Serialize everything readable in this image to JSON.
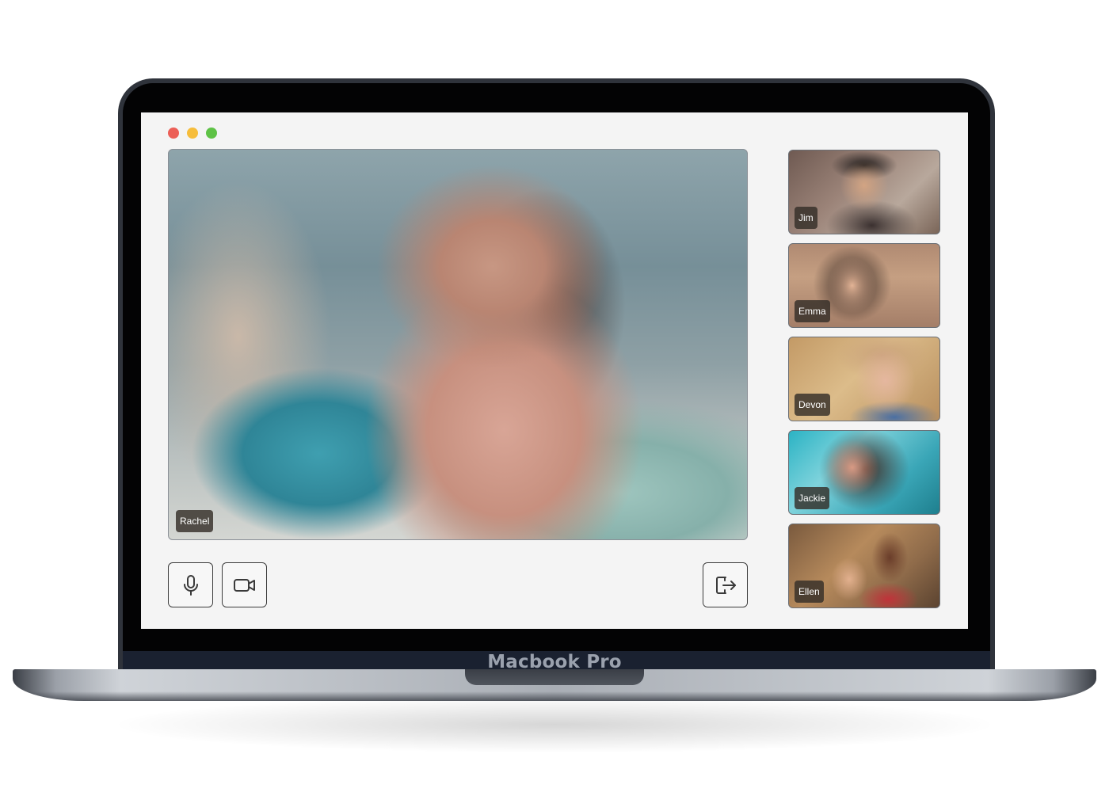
{
  "device": {
    "model_label": "Macbook Pro"
  },
  "window": {
    "traffic_lights": [
      {
        "name": "close",
        "color": "#ec5f57"
      },
      {
        "name": "minimize",
        "color": "#f6bd3b"
      },
      {
        "name": "maximize",
        "color": "#5ec246"
      }
    ]
  },
  "main_video": {
    "participant_name": "Rachel"
  },
  "participants": [
    {
      "name": "Jim"
    },
    {
      "name": "Emma"
    },
    {
      "name": "Devon"
    },
    {
      "name": "Jackie"
    },
    {
      "name": "Ellen"
    }
  ],
  "controls": {
    "mic_icon": "microphone-icon",
    "camera_icon": "video-camera-icon",
    "leave_icon": "exit-icon"
  },
  "colors": {
    "window_background": "#f4f4f4",
    "name_tag_background": "#342e28",
    "device_frame": "#2f333b"
  }
}
